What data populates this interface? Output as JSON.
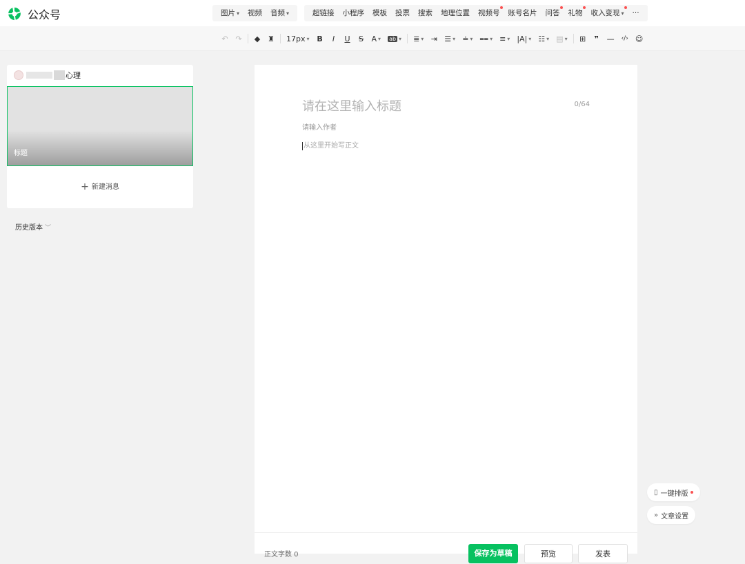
{
  "header": {
    "brand": "公众号",
    "brand_color": "#07c160",
    "menu_group1": [
      {
        "label": "图片",
        "caret": true
      },
      {
        "label": "视频",
        "caret": false
      },
      {
        "label": "音频",
        "caret": true
      }
    ],
    "menu_group2": [
      {
        "label": "超链接",
        "dot": false
      },
      {
        "label": "小程序",
        "dot": false
      },
      {
        "label": "模板",
        "dot": false
      },
      {
        "label": "投票",
        "dot": false
      },
      {
        "label": "搜索",
        "dot": false
      },
      {
        "label": "地理位置",
        "dot": false
      },
      {
        "label": "视频号",
        "dot": true
      },
      {
        "label": "账号名片",
        "dot": false
      },
      {
        "label": "问答",
        "dot": true
      },
      {
        "label": "礼物",
        "dot": true
      },
      {
        "label": "收入变现",
        "dot": true,
        "caret": true
      },
      {
        "label": "···",
        "dot": false
      }
    ]
  },
  "format_toolbar": {
    "font_size": "17px",
    "bold": "B",
    "italic": "I",
    "underline": "U",
    "strike": "S",
    "font_color": "A",
    "bg_color": "ab",
    "quote": "❞",
    "hr": "—",
    "code": "‹/›"
  },
  "left": {
    "account_suffix": "心理",
    "cover_caption": "标题",
    "new_message": "新建消息",
    "history": "历史版本"
  },
  "editor": {
    "title_placeholder": "请在这里输入标题",
    "title_count": "0/64",
    "author_placeholder": "请输入作者",
    "body_placeholder": "从这里开始写正文",
    "word_count": "正文字数 0",
    "save_draft": "保存为草稿",
    "preview": "预览",
    "publish": "发表"
  },
  "floating": {
    "auto_format": "一键排版",
    "article_settings": "文章设置"
  }
}
